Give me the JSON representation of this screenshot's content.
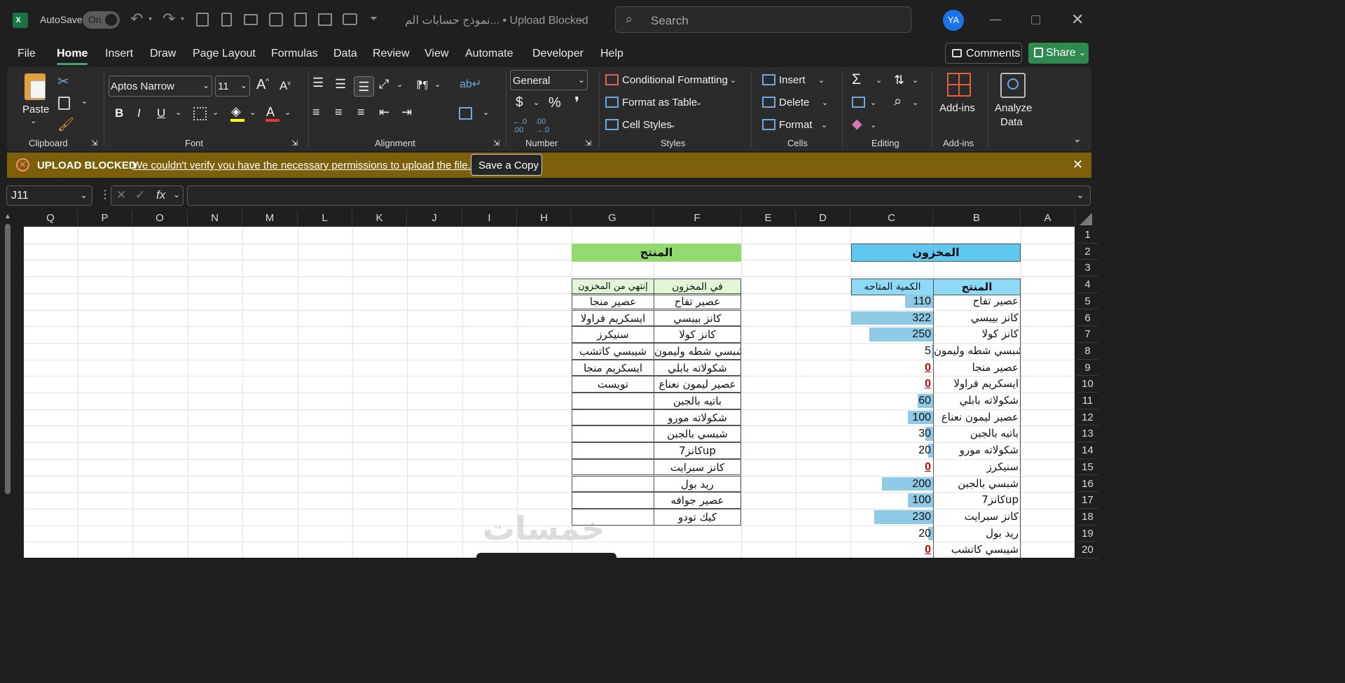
{
  "app": {
    "autosave_label": "AutoSave",
    "autosave_state": "On",
    "title": "نموذج حسابات الم... • Upload Blocked",
    "search_placeholder": "Search",
    "user_initials": "YA"
  },
  "menu": {
    "items": [
      "File",
      "Home",
      "Insert",
      "Draw",
      "Page Layout",
      "Formulas",
      "Data",
      "Review",
      "View",
      "Automate",
      "Developer",
      "Help"
    ],
    "active": "Home",
    "comments_label": "Comments",
    "share_label": "Share"
  },
  "ribbon": {
    "paste_label": "Paste",
    "font_name": "Aptos Narrow",
    "font_size": "11",
    "number_format": "General",
    "conditional_formatting": "Conditional Formatting",
    "format_as_table": "Format as Table",
    "cell_styles": "Cell Styles",
    "insert": "Insert",
    "delete": "Delete",
    "format": "Format",
    "addins": "Add-ins",
    "analyze_data_1": "Analyze",
    "analyze_data_2": "Data",
    "groups": {
      "clipboard": "Clipboard",
      "font": "Font",
      "alignment": "Alignment",
      "number": "Number",
      "styles": "Styles",
      "cells": "Cells",
      "editing": "Editing",
      "addins": "Add-ins"
    },
    "colors": {
      "accent_green": "#47a36b",
      "font_color": "#e03c31",
      "highlight": "#ffff00"
    }
  },
  "banner": {
    "title": "UPLOAD BLOCKED",
    "message": "We couldn't verify you have the necessary permissions to upload the file.",
    "button": "Save a Copy",
    "background": "#7c5f0b"
  },
  "formula_bar": {
    "name_box": "J11",
    "formula": ""
  },
  "sheet": {
    "columns": [
      "Q",
      "P",
      "O",
      "N",
      "M",
      "L",
      "K",
      "J",
      "I",
      "H",
      "G",
      "F",
      "E",
      "D",
      "C",
      "B",
      "A"
    ],
    "rows": [
      "1",
      "2",
      "3",
      "4",
      "5",
      "6",
      "7",
      "8",
      "9",
      "10",
      "11",
      "12",
      "13",
      "14",
      "15",
      "16",
      "17",
      "18",
      "19",
      "20"
    ],
    "inventory_title": "المخزون",
    "inventory_header_product": "المنتج",
    "inventory_header_qty": "الكمية المتاحه",
    "inventory": [
      {
        "product": "عصير تفاح",
        "qty": 110
      },
      {
        "product": "كانز بيبسي",
        "qty": 322
      },
      {
        "product": "كانز كولا",
        "qty": 250
      },
      {
        "product": "شبسي شطه وليمون",
        "qty": 5
      },
      {
        "product": "عصير منجا",
        "qty": 0
      },
      {
        "product": "ايسكريم فراولا",
        "qty": 0
      },
      {
        "product": "شكولاته بابلي",
        "qty": 60
      },
      {
        "product": "عصير ليمون نعناع",
        "qty": 100
      },
      {
        "product": "باتيه بالجبن",
        "qty": 30
      },
      {
        "product": "شكولاته مورو",
        "qty": 20
      },
      {
        "product": "سنيكرز",
        "qty": 0
      },
      {
        "product": "شبسي بالجبن",
        "qty": 200
      },
      {
        "product": "كانز7up",
        "qty": 100
      },
      {
        "product": "كانز سبرايت",
        "qty": 230
      },
      {
        "product": "ريد بول",
        "qty": 20
      },
      {
        "product": "شيبسي كاتشب",
        "qty": 0
      }
    ],
    "status_title": "المنتج",
    "status_header_in": "في المخزون",
    "status_header_out": "إنتهي من المخزون",
    "in_stock": [
      "عصير تفاح",
      "كانز بيبسي",
      "كانز كولا",
      "شبسي شطه وليمون",
      "شكولاته بابلي",
      "عصير ليمون نعناع",
      "باتيه بالجبن",
      "شكولاته مورو",
      "شبسي بالجبن",
      "كانز7up",
      "كانز سبرايت",
      "ريد بول",
      "عصير جوافه",
      "كيك تودو"
    ],
    "out_of_stock": [
      "عصير منجا",
      "ايسكريم فراولا",
      "سنيكرز",
      "شيبسي كاتشب",
      "ايسكريم منجا",
      "تويست"
    ],
    "watermark": "خمسات",
    "colors": {
      "inventory_header": "#5ec8f0",
      "status_header": "#92d96f",
      "databar": "#8ecae6",
      "zero_red": "#d00000"
    }
  }
}
